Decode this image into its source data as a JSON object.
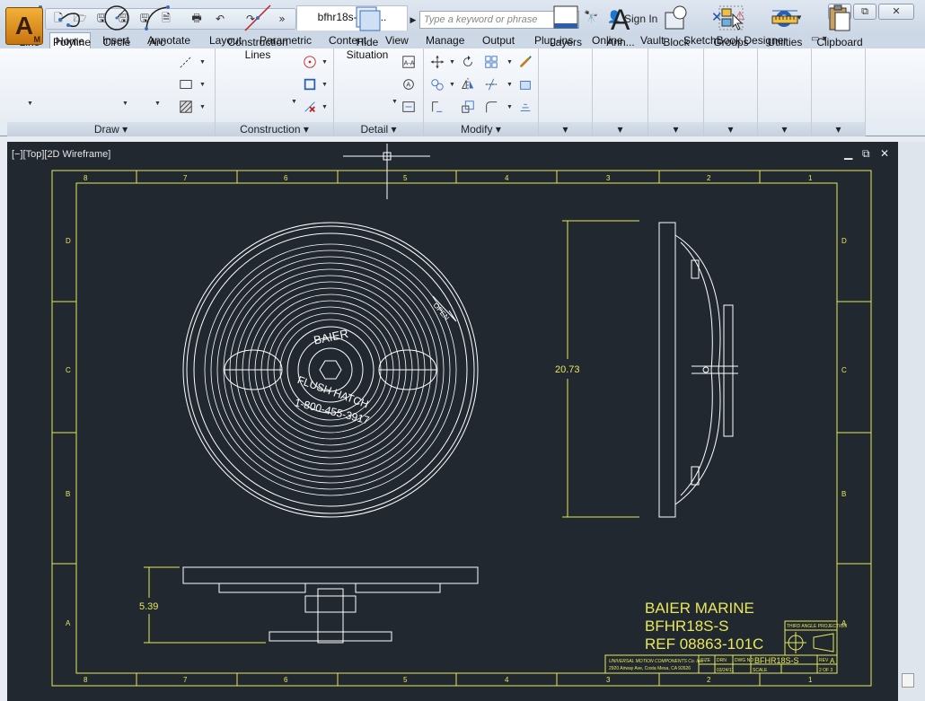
{
  "app": {
    "logo_letter": "A",
    "logo_sub": "M"
  },
  "titlebar": {
    "doc_tab": "bfhr18s-s_2....",
    "search_placeholder": "Type a keyword or phrase",
    "sign_in": "Sign In",
    "window_minimize": "▭",
    "window_restore": "⧉",
    "window_close": "✕"
  },
  "ribbon": {
    "tabs": [
      "Home",
      "Insert",
      "Annotate",
      "Layout",
      "Parametric",
      "Content",
      "View",
      "Manage",
      "Output",
      "Plug-ins",
      "Online",
      "Vault",
      "SketchBook Designer"
    ],
    "active_tab": "Home",
    "panels": {
      "draw": {
        "title": "Draw",
        "line": "Line",
        "polyline": "Polyline",
        "circle": "Circle",
        "arc": "Arc"
      },
      "construction": {
        "title": "Construction",
        "construction_lines_1": "Construction",
        "construction_lines_2": "Lines"
      },
      "detail": {
        "title": "Detail",
        "hide_1": "Hide",
        "hide_2": "Situation"
      },
      "modify": {
        "title": "Modify"
      },
      "layers": {
        "label": "Layers"
      },
      "annotation": {
        "label": "Ann..."
      },
      "block": {
        "label": "Block"
      },
      "groups": {
        "label": "Groups"
      },
      "utilities": {
        "label": "Utilities"
      },
      "clipboard": {
        "label": "Clipboard"
      }
    }
  },
  "viewport": {
    "label": "[−][Top][2D Wireframe]"
  },
  "drawing": {
    "zone_numbers_top": [
      "8",
      "7",
      "6",
      "5",
      "4",
      "3",
      "2",
      "1"
    ],
    "zone_numbers_bottom": [
      "8",
      "7",
      "6",
      "5",
      "4",
      "3",
      "2",
      "1"
    ],
    "zone_letters_left": [
      "D",
      "C",
      "B",
      "A"
    ],
    "zone_letters_right": [
      "D",
      "C",
      "B",
      "A"
    ],
    "dim_height": "20.73",
    "dim_depth": "5.39",
    "hatch_text_top": "BAIER",
    "hatch_text_mid": "FLUSH HATCH",
    "hatch_text_phone": "1-800-455-3917",
    "hatch_text_open": "OPEN",
    "title_line1": "BAIER MARINE",
    "title_line2": "BFHR18S-S",
    "title_line3": "REF 08863-101C",
    "block_company": "UNIVERSAL MOTION COMPONENTS Co. Inc.",
    "block_address": "2920 Airway Ave, Costa Mesa, CA 92626",
    "block_projection": "THIRD ANGLE PROJECTION",
    "block_dwg_no_label": "DWG NO",
    "block_dwg_no": "BFHR18S-S",
    "block_rev_label": "REV",
    "block_rev": "A",
    "block_scale_label": "SCALE",
    "block_sheet": "2 OF 3",
    "block_size": "SIZE",
    "block_drn": "DRN",
    "block_date": "03/24/11"
  },
  "colors": {
    "drawing_bg": "#212830",
    "frame": "#e8e85a",
    "geometry": "#ffffff",
    "ribbon_bg": "#f5f8fc"
  }
}
